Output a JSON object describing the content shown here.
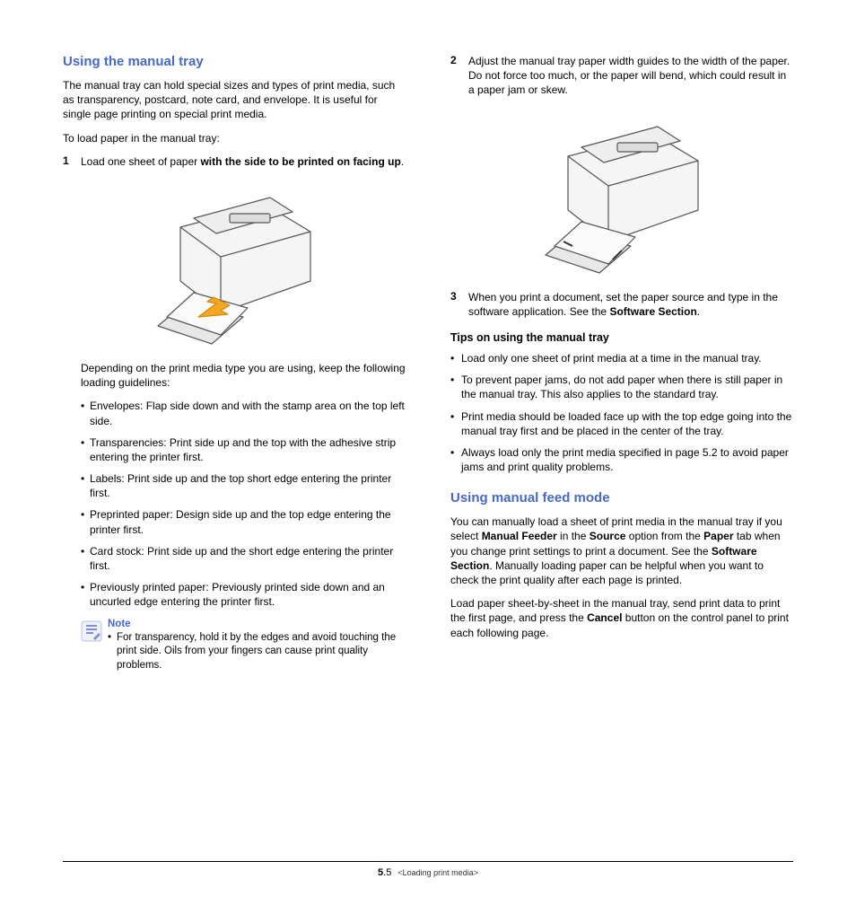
{
  "left": {
    "heading1": "Using the manual tray",
    "intro": "The manual tray can hold special sizes and types of print media, such as transparency, postcard, note card, and envelope. It is useful for single page printing on special print media.",
    "loadLine": "To load paper in the manual tray:",
    "step1Num": "1",
    "step1Pre": "Load one sheet of paper ",
    "step1Bold": "with the side to be printed on facing up",
    "step1Post": ".",
    "dependPara": "Depending on the print media type you are using, keep the following loading guidelines:",
    "bullets": [
      "Envelopes: Flap side down and with the stamp area on the top left side.",
      "Transparencies: Print side up and the top with the adhesive strip entering the printer first.",
      "Labels: Print side up and the top short edge entering the printer first.",
      "Preprinted paper: Design side up and the top edge entering the printer first.",
      "Card stock: Print side up and the short edge entering the printer first.",
      "Previously printed paper: Previously printed side down and an uncurled edge entering the printer first."
    ],
    "noteTitle": "Note",
    "noteText": "For transparency, hold it by the edges and avoid touching the print side. Oils from your fingers can cause print quality problems."
  },
  "right": {
    "step2Num": "2",
    "step2Text": "Adjust the manual tray paper width guides to the width of the paper. Do not force too much, or the paper will bend, which could result in a paper jam or skew.",
    "step3Num": "3",
    "step3Pre": "When you print a document, set the paper source and type in the software application. See the ",
    "step3Bold": "Software Section",
    "step3Post": ".",
    "tipsHead": "Tips on using the manual tray",
    "tips": [
      "Load only one sheet of print media at a time in the manual tray.",
      "To prevent paper jams, do not add paper when there is still paper in the manual tray. This also applies to the standard tray.",
      "Print media should be loaded face up with the top edge going into the manual tray first and be placed in the center of the tray.",
      "Always load only the print media specified in page 5.2 to avoid paper jams and print quality problems."
    ],
    "heading2": "Using manual feed mode",
    "mfPara1a": "You can manually load a sheet of print media in the manual tray if you select ",
    "mfPara1b": "Manual Feeder",
    "mfPara1c": " in the ",
    "mfPara1d": "Source",
    "mfPara1e": " option from the ",
    "mfPara1f": "Paper",
    "mfPara1g": " tab when you change print settings to print a document. See the ",
    "mfPara1h": "Software Section",
    "mfPara1i": ". Manually loading paper can be helpful when you want to check the print quality after each page is printed.",
    "mfPara2a": "Load paper sheet-by-sheet in the manual tray, send print data to print the first page, and press the ",
    "mfPara2b": "Cancel",
    "mfPara2c": " button on the control panel to print each following page."
  },
  "footer": {
    "chapter": "5",
    "page": ".5",
    "title": "<Loading print media>"
  }
}
